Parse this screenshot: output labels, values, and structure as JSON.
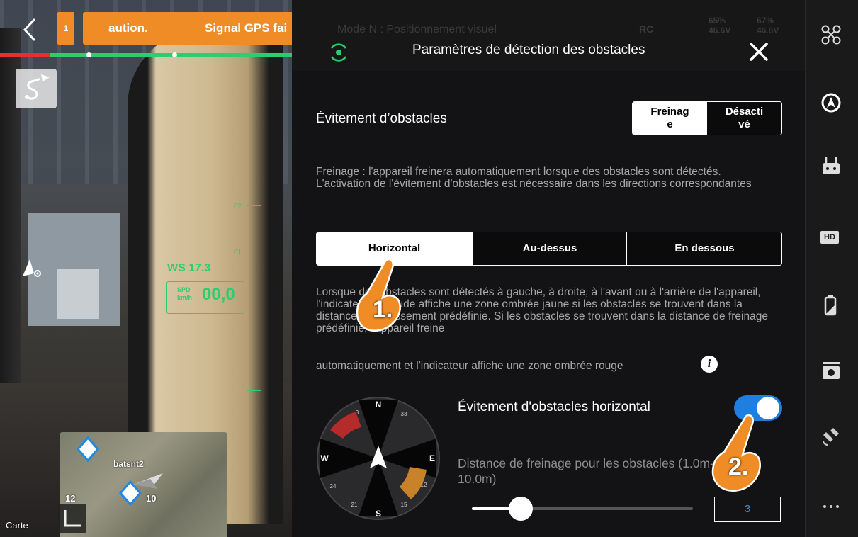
{
  "camera": {
    "warning_count": "1",
    "warning_text_left": "aution.",
    "warning_text_right": "Signal GPS fai",
    "route_icon": "route-icon",
    "hud": {
      "wind_speed": "WS 17.3",
      "speed_label_top": "SPD",
      "speed_label_bottom": "km/h",
      "speed_value": "00,0",
      "tick_top": "02",
      "tick_mid": "01"
    },
    "map": {
      "waypoint_label": "batsnt2",
      "num_left": "12",
      "num_right": "10",
      "map_label": "Carte"
    }
  },
  "topbar_faint": {
    "mode": "Mode N : Positionnement visuel",
    "rc": "RC",
    "battery_1": "65%\n46.6V",
    "battery_2": "67%\n46.6V"
  },
  "panel": {
    "title": "Paramètres de détection des obstacles",
    "obstacle_avoidance": {
      "label": "Évitement d’obstacles",
      "options": [
        "Freinag\ne",
        "Désacti\nvé"
      ],
      "selected": "Freinage"
    },
    "description_brake": "Freinage : l'appareil freinera automatiquement lorsque des obstacles sont détectés. L'activation de l'évitement d'obstacles est nécessaire dans les directions correspondantes",
    "directions": {
      "options": [
        "Horizontal",
        "Au-dessus",
        "En dessous"
      ],
      "selected": "Horizontal"
    },
    "description_horizontal": "Lorsque des obstacles sont détectés à gauche, à droite, à l'avant ou à l'arrière de l'appareil, l'indicateur d'attitude affiche une zone ombrée jaune si les obstacles se trouvent dans la distance d'avertissement prédéfinie. Si les obstacles se trouvent dans la distance de freinage prédéfinie, l'appareil freine",
    "description_horizontal_end": "automatiquement et l'indicateur affiche une zone ombrée rouge",
    "compass": {
      "labels": [
        "N",
        "3",
        "33",
        "E",
        "12",
        "W",
        "24",
        "21",
        "S",
        "15"
      ]
    },
    "horizontal_toggle": {
      "label": "Évitement d'obstacles horizontal",
      "on": true
    },
    "braking_distance": {
      "label": "Distance de freinage pour les obstacles (1.0m-10.0m)",
      "value": "3",
      "range": [
        1.0,
        10.0
      ]
    },
    "annotations": [
      "1.",
      "2."
    ]
  },
  "colors": {
    "accent_blue": "#1f7fe0",
    "warning_orange": "#f08c26",
    "hud_green": "#2ecc71"
  },
  "sidebar": {
    "icons": [
      "drone-icon",
      "obstacle-avoidance-icon",
      "remote-controller-icon",
      "hd-icon",
      "battery-icon",
      "camera-icon",
      "gps-satellite-icon",
      "more-icon"
    ],
    "hd_label": "HD"
  }
}
